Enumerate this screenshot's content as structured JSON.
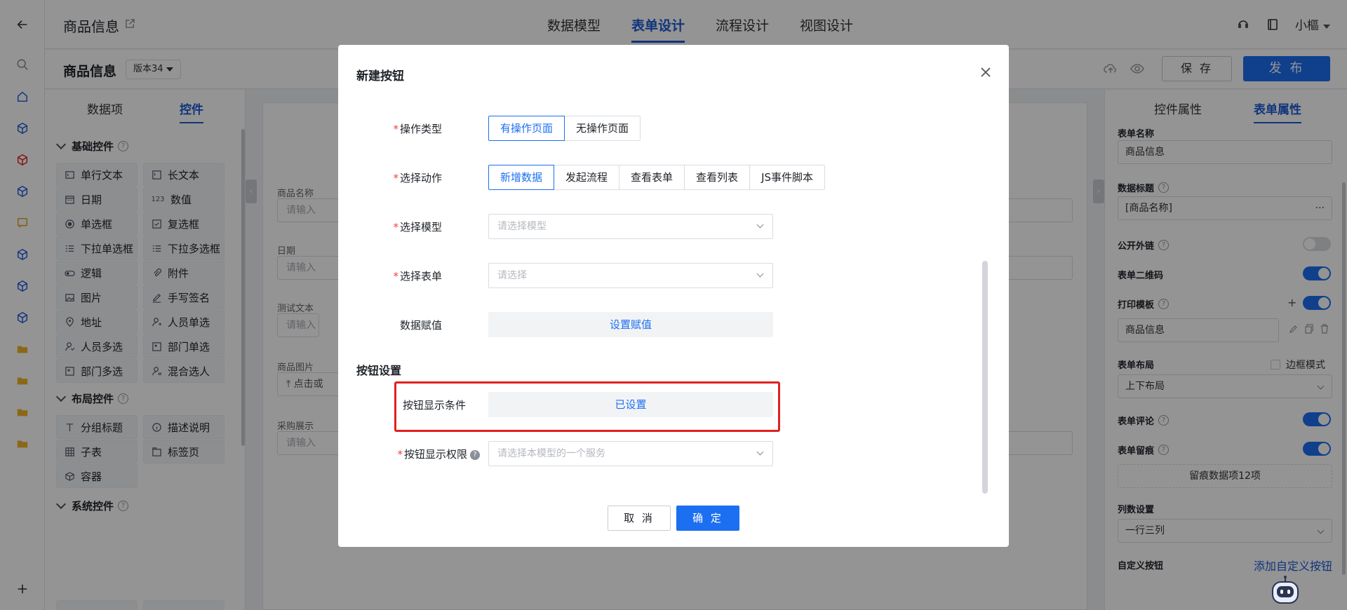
{
  "topbar": {
    "app_title": "商品信息",
    "tabs": [
      "数据模型",
      "表单设计",
      "流程设计",
      "视图设计"
    ],
    "active_tab": "表单设计",
    "user_name": "小樞"
  },
  "subbar": {
    "form_name": "商品信息",
    "version": "版本34",
    "save_label": "保 存",
    "publish_label": "发 布"
  },
  "left_panel": {
    "tabs": [
      "数据项",
      "控件"
    ],
    "groups": [
      {
        "title": "基础控件",
        "items": [
          {
            "label": "单行文本",
            "icon": "text-line-icon"
          },
          {
            "label": "长文本",
            "icon": "text-area-icon"
          },
          {
            "label": "日期",
            "icon": "calendar-icon"
          },
          {
            "label": "数值",
            "icon": "number-icon"
          },
          {
            "label": "单选框",
            "icon": "radio-icon"
          },
          {
            "label": "复选框",
            "icon": "checkbox-icon"
          },
          {
            "label": "下拉单选框",
            "icon": "dropdown-single-icon"
          },
          {
            "label": "下拉多选框",
            "icon": "dropdown-multi-icon"
          },
          {
            "label": "逻辑",
            "icon": "toggle-icon"
          },
          {
            "label": "附件",
            "icon": "paperclip-icon"
          },
          {
            "label": "图片",
            "icon": "image-icon"
          },
          {
            "label": "手写签名",
            "icon": "pen-icon"
          },
          {
            "label": "地址",
            "icon": "location-icon"
          },
          {
            "label": "人员单选",
            "icon": "user-icon"
          },
          {
            "label": "人员多选",
            "icon": "users-icon"
          },
          {
            "label": "部门单选",
            "icon": "dept-icon"
          },
          {
            "label": "部门多选",
            "icon": "dept-multi-icon"
          },
          {
            "label": "混合选人",
            "icon": "user-mixed-icon"
          }
        ]
      },
      {
        "title": "布局控件",
        "items": [
          {
            "label": "分组标题",
            "icon": "heading-icon"
          },
          {
            "label": "描述说明",
            "icon": "info-icon"
          },
          {
            "label": "子表",
            "icon": "table-icon"
          },
          {
            "label": "标签页",
            "icon": "tabs-icon"
          },
          {
            "label": "容器",
            "icon": "container-icon"
          }
        ]
      },
      {
        "title": "系统控件",
        "items": []
      }
    ]
  },
  "canvas": {
    "fields": [
      {
        "label": "商品名称",
        "placeholder": "请输入"
      },
      {
        "label": "日期",
        "placeholder": "请输入"
      },
      {
        "label": "测试文本",
        "placeholder": "请输入"
      },
      {
        "label": "商品图片",
        "placeholder": "点击或"
      },
      {
        "label": "采购展示",
        "placeholder": "请输入"
      }
    ]
  },
  "right_panel": {
    "tabs": [
      "控件属性",
      "表单属性"
    ],
    "form_name_label": "表单名称",
    "form_name_value": "商品信息",
    "data_title_label": "数据标题",
    "data_title_value": "[商品名称]",
    "public_link_label": "公开外链",
    "qrcode_label": "表单二维码",
    "print_template_label": "打印模板",
    "print_template_value": "商品信息",
    "layout_label": "表单布局",
    "border_mode_label": "边框模式",
    "layout_value": "上下布局",
    "comment_label": "表单评论",
    "trace_label": "表单留痕",
    "trace_button": "留痕数据项12项",
    "columns_label": "列数设置",
    "columns_value": "一行三列",
    "custom_button_label": "自定义按钮",
    "add_custom_button": "添加自定义按钮",
    "toggles": {
      "public_link": false,
      "qrcode": true,
      "print_template": true,
      "comment": true,
      "trace": true
    }
  },
  "modal": {
    "title": "新建按钮",
    "operation_type_label": "操作类型",
    "operation_type_options": [
      "有操作页面",
      "无操作页面"
    ],
    "operation_type_selected": "有操作页面",
    "action_label": "选择动作",
    "action_options": [
      "新增数据",
      "发起流程",
      "查看表单",
      "查看列表",
      "JS事件脚本"
    ],
    "action_selected": "新增数据",
    "model_label": "选择模型",
    "model_placeholder": "请选择模型",
    "form_label": "选择表单",
    "form_placeholder": "请选择",
    "assign_label": "数据赋值",
    "assign_button": "设置赋值",
    "section_title": "按钮设置",
    "display_condition_label": "按钮显示条件",
    "display_condition_value": "已设置",
    "permission_label": "按钮显示权限",
    "permission_placeholder": "请选择本模型的一个服务",
    "cancel_label": "取 消",
    "ok_label": "确 定"
  },
  "colors": {
    "primary": "#1d6ff2",
    "highlight_border": "#e02020",
    "required": "#f53f3f"
  }
}
